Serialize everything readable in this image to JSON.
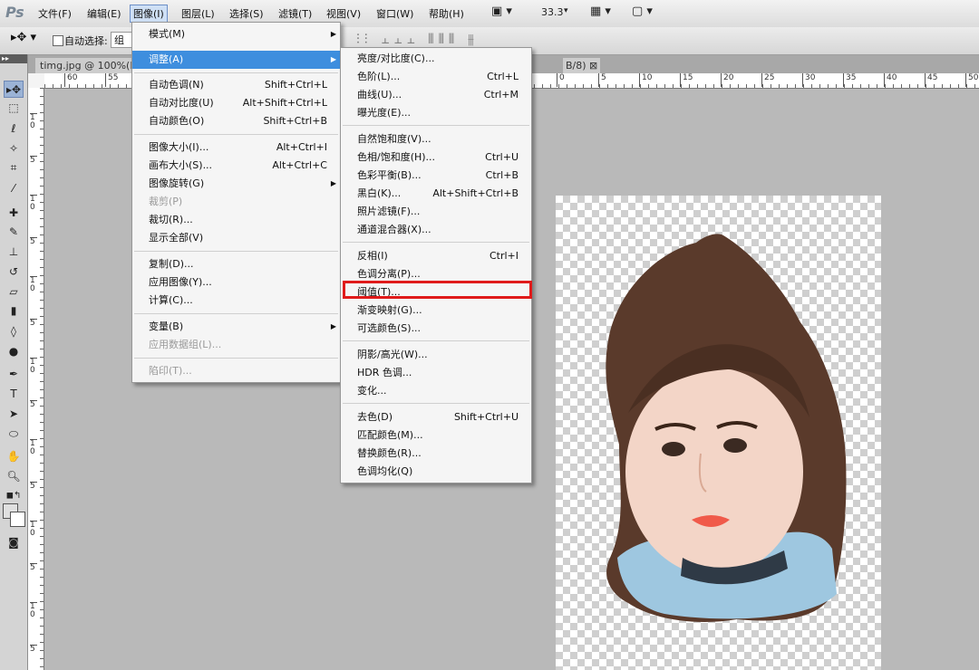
{
  "menubar": {
    "logo": "Ps",
    "items": [
      "文件(F)",
      "编辑(E)",
      "图像(I)",
      "图层(L)",
      "选择(S)",
      "滤镜(T)",
      "视图(V)",
      "窗口(W)",
      "帮助(H)"
    ],
    "zoom": "33.3"
  },
  "options": {
    "auto_select_label": "自动选择:",
    "auto_select_value": "组"
  },
  "tab": {
    "title": "timg.jpg @ 100%(R",
    "tail": "B/8)"
  },
  "rulers": {
    "h_ticks": [
      "60",
      "55",
      "0",
      "5",
      "10",
      "15",
      "20",
      "25",
      "30",
      "35",
      "40",
      "45",
      "50"
    ],
    "v_ticks": [
      "1 0",
      "5",
      "1 0",
      "5",
      "1 0",
      "5",
      "1 0",
      "5",
      "1 0",
      "5",
      "1 0",
      "5",
      "1 0",
      "5"
    ]
  },
  "image_menu": {
    "items": [
      {
        "label": "模式(M)",
        "shortcut": "",
        "submenu": true
      },
      {
        "label": "调整(A)",
        "shortcut": "",
        "submenu": true,
        "highlighted": true
      },
      {
        "label": "自动色调(N)",
        "shortcut": "Shift+Ctrl+L"
      },
      {
        "label": "自动对比度(U)",
        "shortcut": "Alt+Shift+Ctrl+L"
      },
      {
        "label": "自动颜色(O)",
        "shortcut": "Shift+Ctrl+B"
      },
      {
        "label": "图像大小(I)...",
        "shortcut": "Alt+Ctrl+I"
      },
      {
        "label": "画布大小(S)...",
        "shortcut": "Alt+Ctrl+C"
      },
      {
        "label": "图像旋转(G)",
        "shortcut": "",
        "submenu": true
      },
      {
        "label": "裁剪(P)",
        "shortcut": "",
        "disabled": true
      },
      {
        "label": "裁切(R)...",
        "shortcut": ""
      },
      {
        "label": "显示全部(V)",
        "shortcut": ""
      },
      {
        "label": "复制(D)...",
        "shortcut": ""
      },
      {
        "label": "应用图像(Y)...",
        "shortcut": ""
      },
      {
        "label": "计算(C)...",
        "shortcut": ""
      },
      {
        "label": "变量(B)",
        "shortcut": "",
        "submenu": true
      },
      {
        "label": "应用数据组(L)...",
        "shortcut": "",
        "disabled": true
      },
      {
        "label": "陷印(T)...",
        "shortcut": "",
        "disabled": true
      }
    ]
  },
  "adjust_menu": {
    "items": [
      {
        "label": "亮度/对比度(C)...",
        "shortcut": ""
      },
      {
        "label": "色阶(L)...",
        "shortcut": "Ctrl+L"
      },
      {
        "label": "曲线(U)...",
        "shortcut": "Ctrl+M"
      },
      {
        "label": "曝光度(E)...",
        "shortcut": ""
      },
      {
        "label": "自然饱和度(V)...",
        "shortcut": ""
      },
      {
        "label": "色相/饱和度(H)...",
        "shortcut": "Ctrl+U"
      },
      {
        "label": "色彩平衡(B)...",
        "shortcut": "Ctrl+B"
      },
      {
        "label": "黑白(K)...",
        "shortcut": "Alt+Shift+Ctrl+B"
      },
      {
        "label": "照片滤镜(F)...",
        "shortcut": ""
      },
      {
        "label": "通道混合器(X)...",
        "shortcut": ""
      },
      {
        "label": "反相(I)",
        "shortcut": "Ctrl+I"
      },
      {
        "label": "色调分离(P)...",
        "shortcut": ""
      },
      {
        "label": "阈值(T)...",
        "shortcut": "",
        "annotated": true
      },
      {
        "label": "渐变映射(G)...",
        "shortcut": ""
      },
      {
        "label": "可选颜色(S)...",
        "shortcut": ""
      },
      {
        "label": "阴影/高光(W)...",
        "shortcut": ""
      },
      {
        "label": "HDR 色调...",
        "shortcut": ""
      },
      {
        "label": "变化...",
        "shortcut": ""
      },
      {
        "label": "去色(D)",
        "shortcut": "Shift+Ctrl+U"
      },
      {
        "label": "匹配颜色(M)...",
        "shortcut": ""
      },
      {
        "label": "替换颜色(R)...",
        "shortcut": ""
      },
      {
        "label": "色调均化(Q)",
        "shortcut": ""
      }
    ]
  },
  "colors": {
    "highlight": "#3e8ede",
    "annotation": "#e01a1a"
  }
}
